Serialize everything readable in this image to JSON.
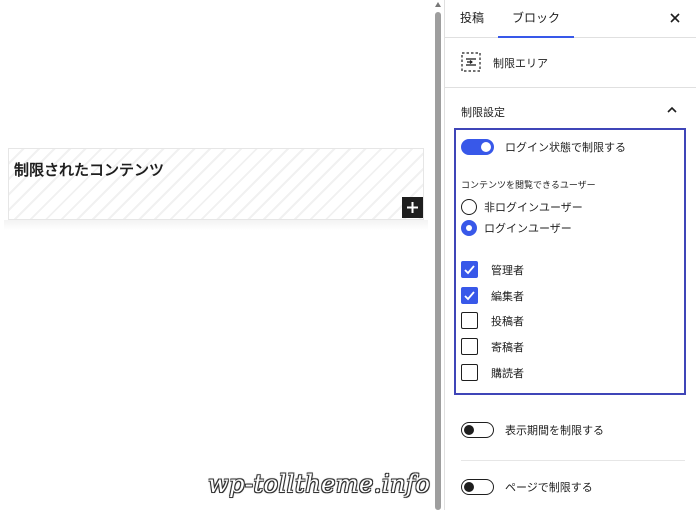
{
  "editor": {
    "block_title": "制限されたコンテンツ",
    "add_block_glyph": "+",
    "watermark": "wp-tolltheme.info"
  },
  "sidebar": {
    "tabs": [
      {
        "label": "投稿",
        "active": false
      },
      {
        "label": "ブロック",
        "active": true
      }
    ],
    "close_glyph": "✕",
    "block_card": {
      "icon": "restrict-area-icon",
      "title": "制限エリア"
    },
    "panel": {
      "title": "制限設定",
      "expanded": true,
      "login_toggle": {
        "label": "ログイン状態で制限する",
        "on": true
      },
      "viewer_group": {
        "label": "コンテンツを閲覧できるユーザー",
        "options": [
          {
            "label": "非ログインユーザー",
            "checked": false
          },
          {
            "label": "ログインユーザー",
            "checked": true
          }
        ]
      },
      "roles": [
        {
          "label": "管理者",
          "checked": true
        },
        {
          "label": "編集者",
          "checked": true
        },
        {
          "label": "投稿者",
          "checked": false
        },
        {
          "label": "寄稿者",
          "checked": false
        },
        {
          "label": "購読者",
          "checked": false
        }
      ],
      "period_toggle": {
        "label": "表示期間を制限する",
        "on": false
      },
      "page_toggle": {
        "label": "ページで制限する",
        "on": false
      }
    }
  },
  "colors": {
    "accent": "#3858e9",
    "highlight_border": "#3f45b8",
    "text": "#1e1e1e"
  }
}
